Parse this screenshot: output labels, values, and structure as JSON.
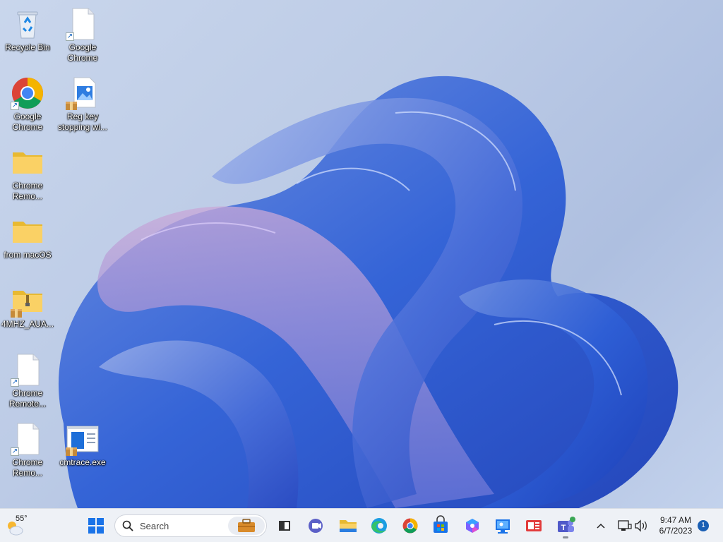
{
  "desktop": {
    "icons": [
      {
        "label": "Recycle Bin",
        "icon": "recycle-bin-icon"
      },
      {
        "label": "Google Chrome",
        "icon": "file-shortcut-icon"
      },
      {
        "label": "Google Chrome",
        "icon": "chrome-icon"
      },
      {
        "label": "Reg key stopping wi...",
        "icon": "image-file-icon"
      },
      {
        "label": "Chrome Remo...",
        "icon": "folder-icon"
      },
      {
        "label": "from macOS",
        "icon": "folder-icon"
      },
      {
        "label": "4MHZ_AUA...",
        "icon": "zip-folder-icon"
      },
      {
        "label": "Chrome Remote...",
        "icon": "file-shortcut-icon"
      },
      {
        "label": "Chrome Remo...",
        "icon": "file-shortcut-icon"
      },
      {
        "label": "cmtrace.exe",
        "icon": "app-window-icon"
      }
    ]
  },
  "taskbar": {
    "weather": {
      "temp": "55°",
      "icon": "weather-sun-cloud-icon"
    },
    "search_placeholder": "Search",
    "apps": [
      {
        "name": "start",
        "icon": "windows-start-icon"
      },
      {
        "name": "task-view",
        "icon": "task-view-icon"
      },
      {
        "name": "meet",
        "icon": "video-chat-icon"
      },
      {
        "name": "file-explorer",
        "icon": "folder-icon"
      },
      {
        "name": "edge",
        "icon": "edge-icon"
      },
      {
        "name": "chrome",
        "icon": "chrome-icon"
      },
      {
        "name": "store",
        "icon": "store-icon"
      },
      {
        "name": "copilot",
        "icon": "copilot-icon"
      },
      {
        "name": "remote-desktop",
        "icon": "remote-desktop-icon"
      },
      {
        "name": "news",
        "icon": "news-icon"
      },
      {
        "name": "teams",
        "icon": "teams-icon"
      }
    ],
    "clock": {
      "time": "9:47 AM",
      "date": "6/7/2023"
    },
    "notification_count": "1",
    "colors": {
      "accent": "#1a5fb4",
      "taskbar_bg": "#eef1f6"
    }
  }
}
